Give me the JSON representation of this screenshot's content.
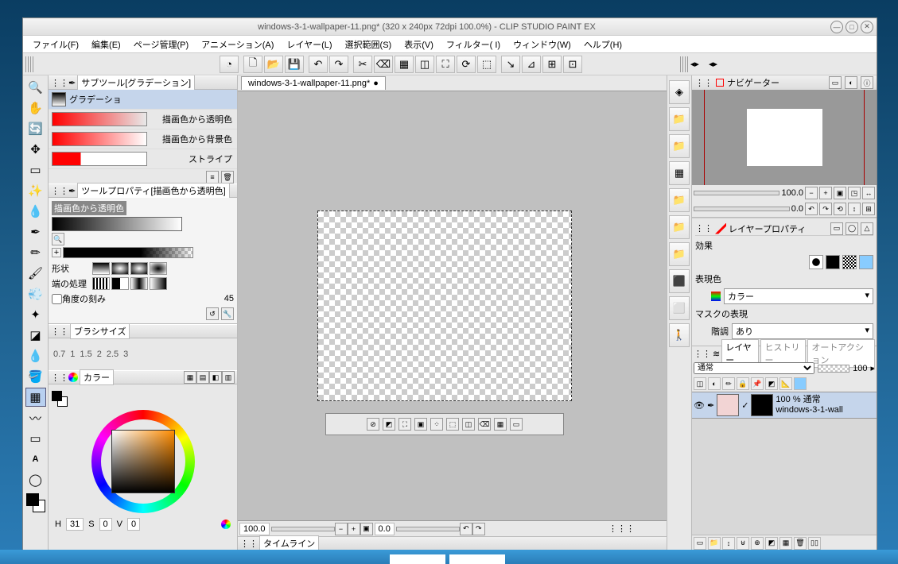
{
  "title": "windows-3-1-wallpaper-11.png* (320 x 240px 72dpi 100.0%)   - CLIP STUDIO PAINT EX",
  "menu": [
    "ファイル(F)",
    "編集(E)",
    "ページ管理(P)",
    "アニメーション(A)",
    "レイヤー(L)",
    "選択範囲(S)",
    "表示(V)",
    "フィルター( I)",
    "ウィンドウ(W)",
    "ヘルプ(H)"
  ],
  "doc_tab": "windows-3-1-wallpaper-11.png*",
  "subtool_panel": "サブツール[グラデーション]",
  "subtool_selected": "グラデーショ",
  "gradients": [
    {
      "label": "描画色から透明色",
      "css": "linear-gradient(to right,#ff0000,rgba(255,0,0,0))"
    },
    {
      "label": "描画色から背景色",
      "css": "linear-gradient(to right,#ff0000,#ffffff)"
    },
    {
      "label": "ストライプ",
      "css": "linear-gradient(to right,#ff0000 30%,#ffffff 30%)"
    }
  ],
  "toolprop_panel": "ツールプロパティ[描画色から透明色]",
  "toolprop_name": "描画色から透明色",
  "shape_label": "形状",
  "edge_label": "端の処理",
  "angle_label": "角度の刻み",
  "angle_value": "45",
  "brushsize_panel": "ブラシサイズ",
  "brush_sizes": [
    "0.7",
    "1",
    "1.5",
    "2",
    "2.5",
    "3"
  ],
  "color_panel": "カラー",
  "hsv": {
    "h": "31",
    "s": "0",
    "v": "0"
  },
  "hsv_labels": {
    "h": "H",
    "s": "S",
    "v": "V"
  },
  "timeline_label": "タイムライン",
  "canvas_zoom": "100.0",
  "canvas_angle": "0.0",
  "navigator": {
    "label": "ナビゲーター",
    "zoom": "100.0",
    "angle": "0.0"
  },
  "layerprop": {
    "label": "レイヤープロパティ",
    "effect": "効果",
    "expr": "表現色",
    "expr_val": "カラー",
    "mask": "マスクの表現",
    "tone": "階調",
    "tone_val": "あり"
  },
  "layers": {
    "label": "レイヤー",
    "history": "ヒストリー",
    "auto": "オートアクション",
    "mode": "通常",
    "opacity": "100",
    "item_opacity": "100 %",
    "item_mode": "通常",
    "item_name": "windows-3-1-wall"
  }
}
